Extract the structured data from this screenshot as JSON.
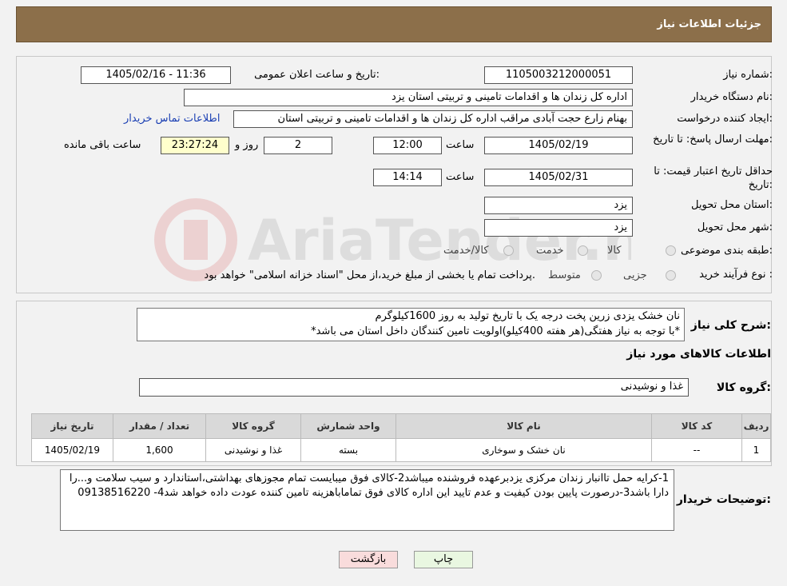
{
  "header": {
    "title": "جزئیات اطلاعات نیاز"
  },
  "fields": {
    "need_number_label": "شماره نیاز:",
    "need_number": "1105003212000051",
    "announce_label": "تاریخ و ساعت اعلان عمومی:",
    "announce_value": "1405/02/16 - 11:36",
    "buyer_org_label": "نام دستگاه خریدار:",
    "buyer_org": "اداره کل زندان ها و اقدامات تامینی و تربیتی استان یزد",
    "requester_label": "ایجاد کننده درخواست:",
    "requester": "بهنام زارع حجت آبادی مراقب اداره کل زندان ها و اقدامات تامینی و تربیتی استان",
    "contact_link": "اطلاعات تماس خریدار",
    "deadline_label": "مهلت ارسال پاسخ: تا تاریخ:",
    "deadline_date": "1405/02/19",
    "time_label": "ساعت",
    "deadline_time": "12:00",
    "days_value": "2",
    "days_label": "روز و",
    "remaining_time": "23:27:24",
    "remaining_label": "ساعت باقی مانده",
    "validity_label": "حداقل تاریخ اعتبار قیمت: تا تاریخ:",
    "validity_date": "1405/02/31",
    "validity_time": "14:14",
    "province_label": "استان محل تحویل:",
    "province": "یزد",
    "city_label": "شهر محل تحویل:",
    "city": "یزد",
    "category_label": "طبقه بندی موضوعی:",
    "category_options": [
      "کالا",
      "خدمت",
      "کالا/خدمت"
    ],
    "process_label": "نوع فرآیند خرید :",
    "process_options": [
      "جزیی",
      "متوسط"
    ],
    "process_note": "پرداخت تمام یا بخشی از مبلغ خرید،از محل \"اسناد خزانه اسلامی\" خواهد بود."
  },
  "description": {
    "label": "شرح کلی نیاز:",
    "line1": "نان خشک یزدی زرین پخت درجه یک با تاریخ تولید به روز 1600کیلوگرم",
    "line2": "*با توجه به نیاز هفتگی(هر هفته 400کیلو)اولویت تامین کنندگان داخل استان می باشد*"
  },
  "goods": {
    "section_title": "اطلاعات کالاهای مورد نیاز",
    "group_label": "گروه کالا:",
    "group_value": "غذا و نوشیدنی",
    "columns": [
      "ردیف",
      "کد کالا",
      "نام کالا",
      "واحد شمارش",
      "گروه کالا",
      "تعداد / مقدار",
      "تاریخ نیاز"
    ],
    "rows": [
      [
        "1",
        "--",
        "نان خشک و سوخاری",
        "بسته",
        "غذا و نوشیدنی",
        "1,600",
        "1405/02/19"
      ]
    ]
  },
  "buyer_notes": {
    "label": "توضیحات خریدار:",
    "text": "1-کرایه حمل تاانبار زندان مرکزی یزدبرعهده فروشنده میباشد2-کالای فوق میبایست تمام مجوزهای بهداشتی،استاندارد و سیب سلامت و...را دارا باشد3-درصورت پایین بودن کیفیت و عدم تایید این اداره کالای فوق تماماباهزینه تامین کننده عودت داده خواهد شد4- 09138516220"
  },
  "buttons": {
    "print": "چاپ",
    "back": "بازگشت"
  },
  "watermark": {
    "text": "AriaTender.neT"
  },
  "colors": {
    "header_bg": "#8c6f4a",
    "back_button_bg": "#f9dcdc",
    "print_button_bg": "#e9f7e1",
    "remaining_bg": "#ffffcc"
  }
}
